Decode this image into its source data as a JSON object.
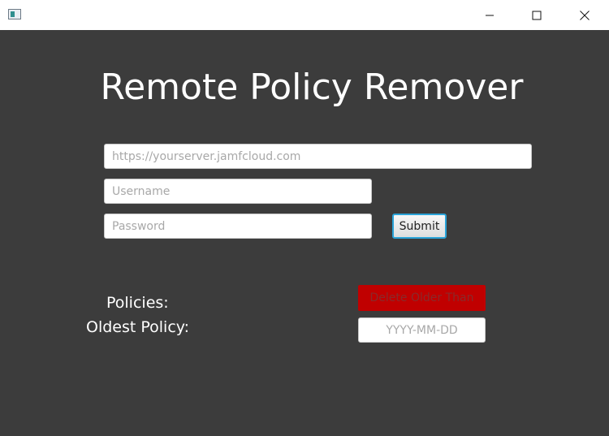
{
  "window": {
    "controls": {
      "minimize_icon": "minimize-icon",
      "maximize_icon": "maximize-icon",
      "close_icon": "close-icon"
    }
  },
  "main": {
    "title": "Remote Policy Remover",
    "server": {
      "placeholder": "https://yourserver.jamfcloud.com",
      "value": ""
    },
    "username": {
      "placeholder": "Username",
      "value": ""
    },
    "password": {
      "placeholder": "Password",
      "value": ""
    },
    "submit_label": "Submit",
    "policies_label": "Policies:",
    "oldest_policy_label": "Oldest Policy:",
    "delete_label": "Delete Older Than",
    "date": {
      "placeholder": "YYYY-MM-DD",
      "value": ""
    }
  },
  "colors": {
    "background": "#3c3c3c",
    "delete_button": "#c00000",
    "submit_focus_border": "#2aa3d8"
  }
}
